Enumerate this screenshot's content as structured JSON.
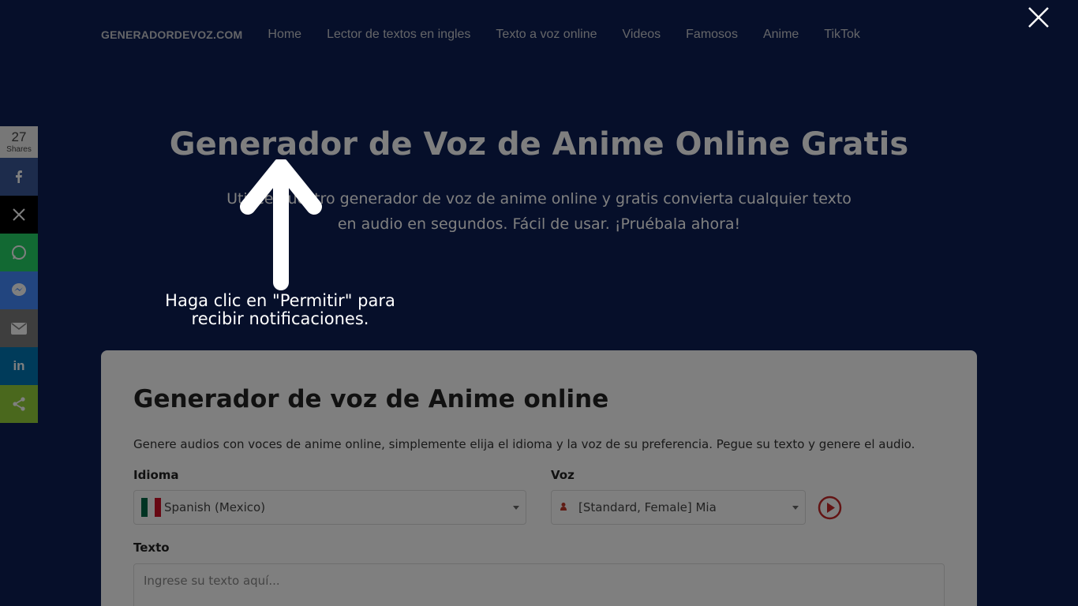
{
  "nav": {
    "brand": "GENERADORDEVOZ.COM",
    "links": [
      "Home",
      "Lector de textos en ingles",
      "Texto a voz online",
      "Videos",
      "Famosos",
      "Anime",
      "TikTok"
    ]
  },
  "hero": {
    "title": "Generador de Voz de Anime Online Gratis",
    "subtitle": "Utilice nuestro generador de voz de anime online y gratis convierta cualquier texto en audio en segundos. Fácil de usar. ¡Pruébala ahora!"
  },
  "card": {
    "title": "Generador de voz de Anime online",
    "description": "Genere audios con voces de anime online, simplemente elija el idioma y la voz de su preferencia. Pegue su texto y genere el audio.",
    "language_label": "Idioma",
    "language_value": "Spanish (Mexico)",
    "voice_label": "Voz",
    "voice_value": "[Standard, Female] Mia",
    "text_label": "Texto",
    "text_placeholder": "Ingrese su texto aquí..."
  },
  "share": {
    "count": "27",
    "count_label": "Shares",
    "buttons": [
      {
        "name": "facebook",
        "color": "#3b5998",
        "icon": "facebook-icon"
      },
      {
        "name": "x",
        "color": "#000000",
        "icon": "x-icon"
      },
      {
        "name": "whatsapp",
        "color": "#25d366",
        "icon": "whatsapp-icon"
      },
      {
        "name": "messenger",
        "color": "#448aff",
        "icon": "messenger-icon"
      },
      {
        "name": "email",
        "color": "#7d7d7d",
        "icon": "email-icon"
      },
      {
        "name": "linkedin",
        "color": "#0077b5",
        "icon": "linkedin-icon"
      },
      {
        "name": "sharethis",
        "color": "#95d03a",
        "icon": "share-icon"
      }
    ]
  },
  "overlay": {
    "notification_text": "Haga clic en \"Permitir\" para recibir notificaciones."
  }
}
